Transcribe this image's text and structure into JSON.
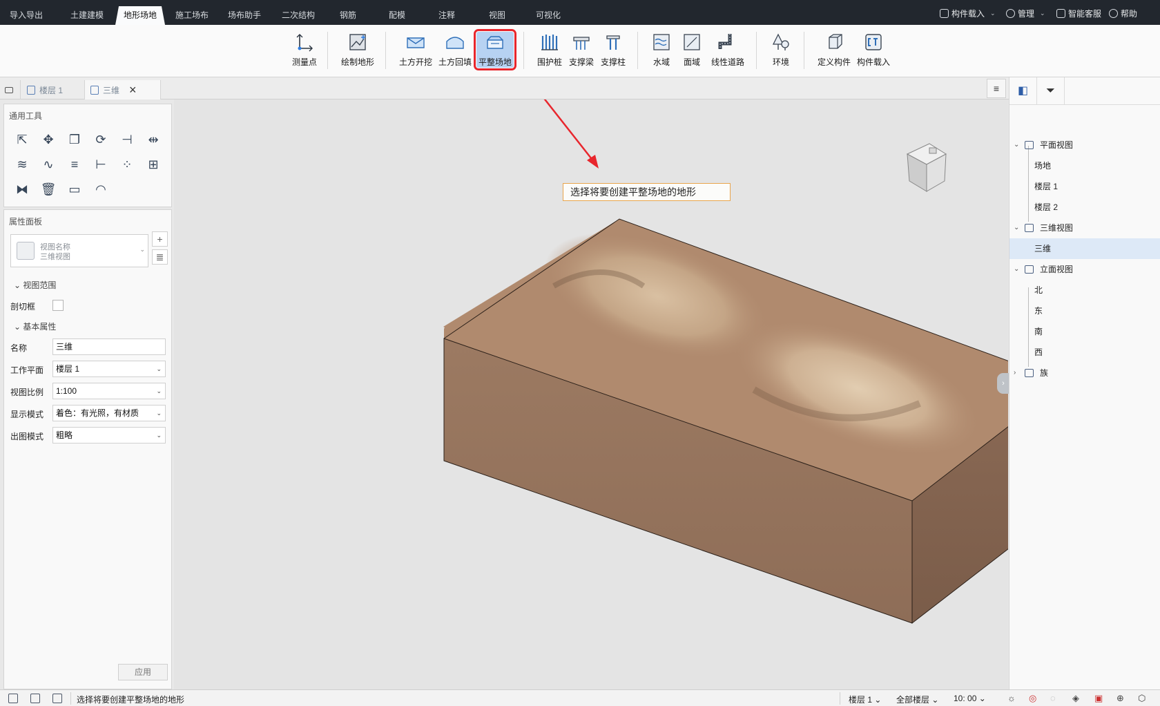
{
  "menu_tabs": [
    "导入导出",
    "土建建模",
    "地形场地",
    "施工场布",
    "场布助手",
    "二次结构",
    "钢筋",
    "配模",
    "注释",
    "视图",
    "可视化"
  ],
  "active_menu": "地形场地",
  "top_right": {
    "load": "构件载入",
    "manage": "管理",
    "service": "智能客服",
    "help": "帮助"
  },
  "ribbon": {
    "measure": "测量点",
    "draw_terrain": "绘制地形",
    "excavate": "土方开挖",
    "backfill": "土方回填",
    "level_site": "平整场地",
    "pile": "围护桩",
    "brace_beam": "支撑梁",
    "brace_col": "支撑柱",
    "water": "水域",
    "area": "面域",
    "road": "线性道路",
    "environment": "环境",
    "define_comp": "定义构件",
    "load_comp": "构件载入"
  },
  "doc_tabs": {
    "floor1": "楼层 1",
    "view3d": "三维"
  },
  "left_panel": {
    "general_tools": "通用工具",
    "property_panel": "属性面板",
    "view_name_label": "视图名称",
    "view_name_value": "三维视图",
    "view_range": "视图范围",
    "section_box": "剖切框",
    "basic_props": "基本属性",
    "props": [
      {
        "key": "名称",
        "value": "三维"
      },
      {
        "key": "工作平面",
        "value": "楼层 1"
      },
      {
        "key": "视图比例",
        "value": "1:100"
      },
      {
        "key": "显示模式",
        "value": "着色：有光照，有材质"
      },
      {
        "key": "出图模式",
        "value": "粗略"
      }
    ],
    "apply": "应用"
  },
  "tooltip": "选择将要创建平整场地的地形",
  "tree": {
    "plan_views": "平面视图",
    "site": "场地",
    "floor1": "楼层 1",
    "floor2": "楼层 2",
    "views3d": "三维视图",
    "view3d": "三维",
    "elevations": "立面视图",
    "north": "北",
    "east": "东",
    "south": "南",
    "west": "西",
    "family": "族"
  },
  "status": {
    "message": "选择将要创建平整场地的地形",
    "floor": "楼层 1",
    "all_floors": "全部楼层",
    "time": "10: 00"
  },
  "colors": {
    "dark_bar": "#22272e",
    "highlight": "#e8262d",
    "terrain": "#b08a6e",
    "selection": "#b7d2f2"
  }
}
